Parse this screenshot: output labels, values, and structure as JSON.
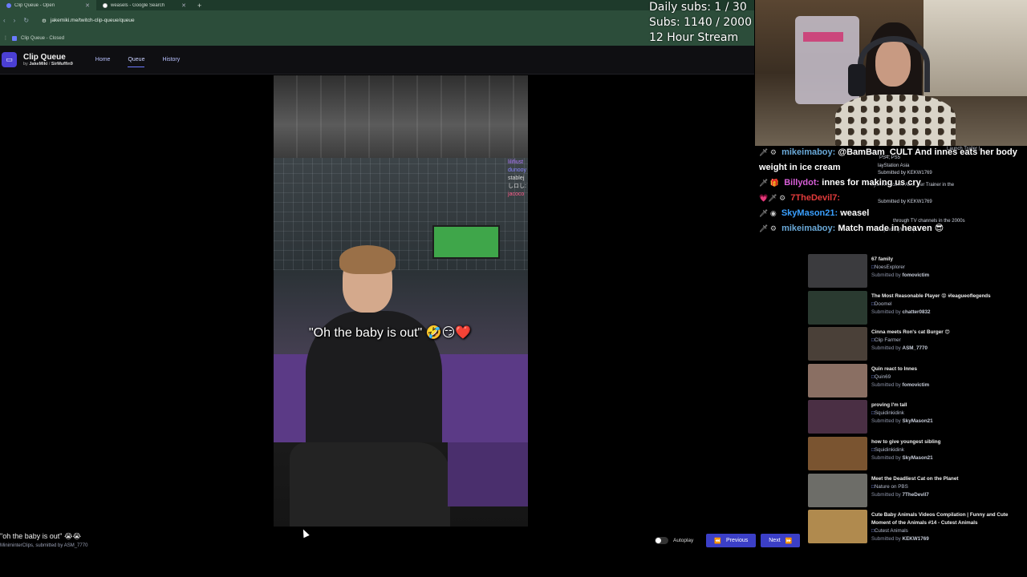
{
  "browser": {
    "tabs": [
      {
        "title": "Clip Queue - Open",
        "active": true
      },
      {
        "title": "weasels - Google Search",
        "active": false
      }
    ],
    "new_tab": "+",
    "url": "jakemiki.me/twitch-clip-queue/queue",
    "bookmark": "Clip Queue - Closed"
  },
  "app": {
    "name": "Clip Queue",
    "by_label": "by",
    "author1": "JakeMiki",
    "sep": "/",
    "author2": "SirMuffin9",
    "nav": [
      "Home",
      "Queue",
      "History"
    ]
  },
  "video": {
    "caption": "\"Oh the baby is out\" 🤣😏❤️",
    "embedded_chat": [
      "lilifiust",
      "dunooy",
      "stablej",
      "しロし:",
      "jacoco"
    ]
  },
  "current_clip": {
    "title": "\"oh the baby is out\" 😭😭",
    "channel": "MiniminterClips",
    "submitted_text": ", submitted by",
    "submitter": "ASM_7770"
  },
  "controls": {
    "autoplay_label": "Autoplay",
    "previous_label": "Previous",
    "next_label": "Next"
  },
  "stream_stats": {
    "line1": "Daily subs: 1 / 30",
    "line2": "Subs: 1140 / 2000",
    "line3": "12 Hour Stream"
  },
  "chat": [
    {
      "badges": "🗡 ⚙",
      "user": "mikeimaboy:",
      "color": "#6aa9d8",
      "message": "@BamBam_CULT And innes eats her body weight in ice cream"
    },
    {
      "badges": "🗡 🎁",
      "user": "Billydot:",
      "color": "#d85fd8",
      "message": "innes for making us cry"
    },
    {
      "badges": "💗🗡 ⚙",
      "user": "7TheDevil7:",
      "color": "#e23b3b",
      "message": ""
    },
    {
      "badges": "🗡 ◉",
      "user": "SkyMason21:",
      "color": "#3aa0ff",
      "message": "weasel"
    },
    {
      "badges": "🗡 ⚙",
      "user": "mikeimaboy:",
      "color": "#6aa9d8",
      "message": "Match made in heaven 😎"
    }
  ],
  "queue_partial": [
    {
      "text": "Launch Trailer |"
    },
    {
      "text": "PS4, PS5"
    },
    {
      "text": "layStation Asia"
    },
    {
      "text": "Submitted by KEKW1769"
    },
    {
      "text": "Sydme Account Asks Her Trainer in the"
    },
    {
      "text": "Submitted by KEKW1769"
    },
    {
      "text": "through TV channels in the 2000s"
    },
    {
      "text": "PaymoneyWubby"
    }
  ],
  "queue": [
    {
      "title": "67 family",
      "channel": "NoesExplorer",
      "submitter": "fomovictim",
      "color": "#3b3b3e"
    },
    {
      "title": "The Most Reasonable Player 😡 #leagueoflegends",
      "channel": "Doomel",
      "submitter": "chatter0832",
      "color": "#2a3a30"
    },
    {
      "title": "Cinna meets Ron's cat Burger 😍",
      "channel": "Clip Farmer",
      "submitter": "ASM_7770",
      "color": "#4a4038"
    },
    {
      "title": "Quin react to Innes",
      "channel": "Quin69",
      "submitter": "fomovictim",
      "color": "#8a6f63"
    },
    {
      "title": "proving I'm tall",
      "channel": "Squidinkidink",
      "submitter": "SkyMason21",
      "color": "#4a2f44"
    },
    {
      "title": "how to give youngest sibling",
      "channel": "Squidinkidink",
      "submitter": "SkyMason21",
      "color": "#7a5430"
    },
    {
      "title": "Meet the Deadliest Cat on the Planet",
      "channel": "Nature on PBS",
      "submitter": "7TheDevil7",
      "color": "#6d6d68"
    },
    {
      "title": "Cute Baby Animals Videos Compilation | Funny and Cute Moment of the Animals #14 - Cutest Animals",
      "channel": "Cutest Animals",
      "submitter": "KEKW1769",
      "color": "#b08a4e"
    }
  ],
  "submitted_label": "Submitted by"
}
